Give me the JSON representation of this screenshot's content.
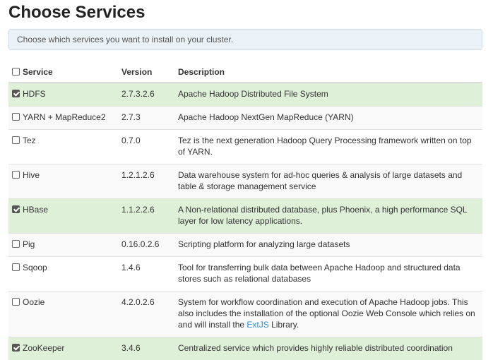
{
  "title": "Choose Services",
  "info": "Choose which services you want to install on your cluster.",
  "headers": {
    "service": "Service",
    "version": "Version",
    "description": "Description"
  },
  "rows": [
    {
      "name": "HDFS",
      "version": "2.7.3.2.6",
      "description": "Apache Hadoop Distributed File System",
      "checked": true
    },
    {
      "name": "YARN + MapReduce2",
      "version": "2.7.3",
      "description": "Apache Hadoop NextGen MapReduce (YARN)",
      "checked": false
    },
    {
      "name": "Tez",
      "version": "0.7.0",
      "description": "Tez is the next generation Hadoop Query Processing framework written on top of YARN.",
      "checked": false
    },
    {
      "name": "Hive",
      "version": "1.2.1.2.6",
      "description": "Data warehouse system for ad-hoc queries & analysis of large datasets and table & storage management service",
      "checked": false
    },
    {
      "name": "HBase",
      "version": "1.1.2.2.6",
      "description": "A Non-relational distributed database, plus Phoenix, a high performance SQL layer for low latency applications.",
      "checked": true
    },
    {
      "name": "Pig",
      "version": "0.16.0.2.6",
      "description": "Scripting platform for analyzing large datasets",
      "checked": false
    },
    {
      "name": "Sqoop",
      "version": "1.4.6",
      "description": "Tool for transferring bulk data between Apache Hadoop and structured data stores such as relational databases",
      "checked": false
    },
    {
      "name": "Oozie",
      "version": "4.2.0.2.6",
      "description": "System for workflow coordination and execution of Apache Hadoop jobs. This also includes the installation of the optional Oozie Web Console which relies on and will install the ",
      "link": "ExtJS",
      "description_after": " Library.",
      "checked": false
    },
    {
      "name": "ZooKeeper",
      "version": "3.4.6",
      "description": "Centralized service which provides highly reliable distributed coordination",
      "checked": true
    }
  ]
}
